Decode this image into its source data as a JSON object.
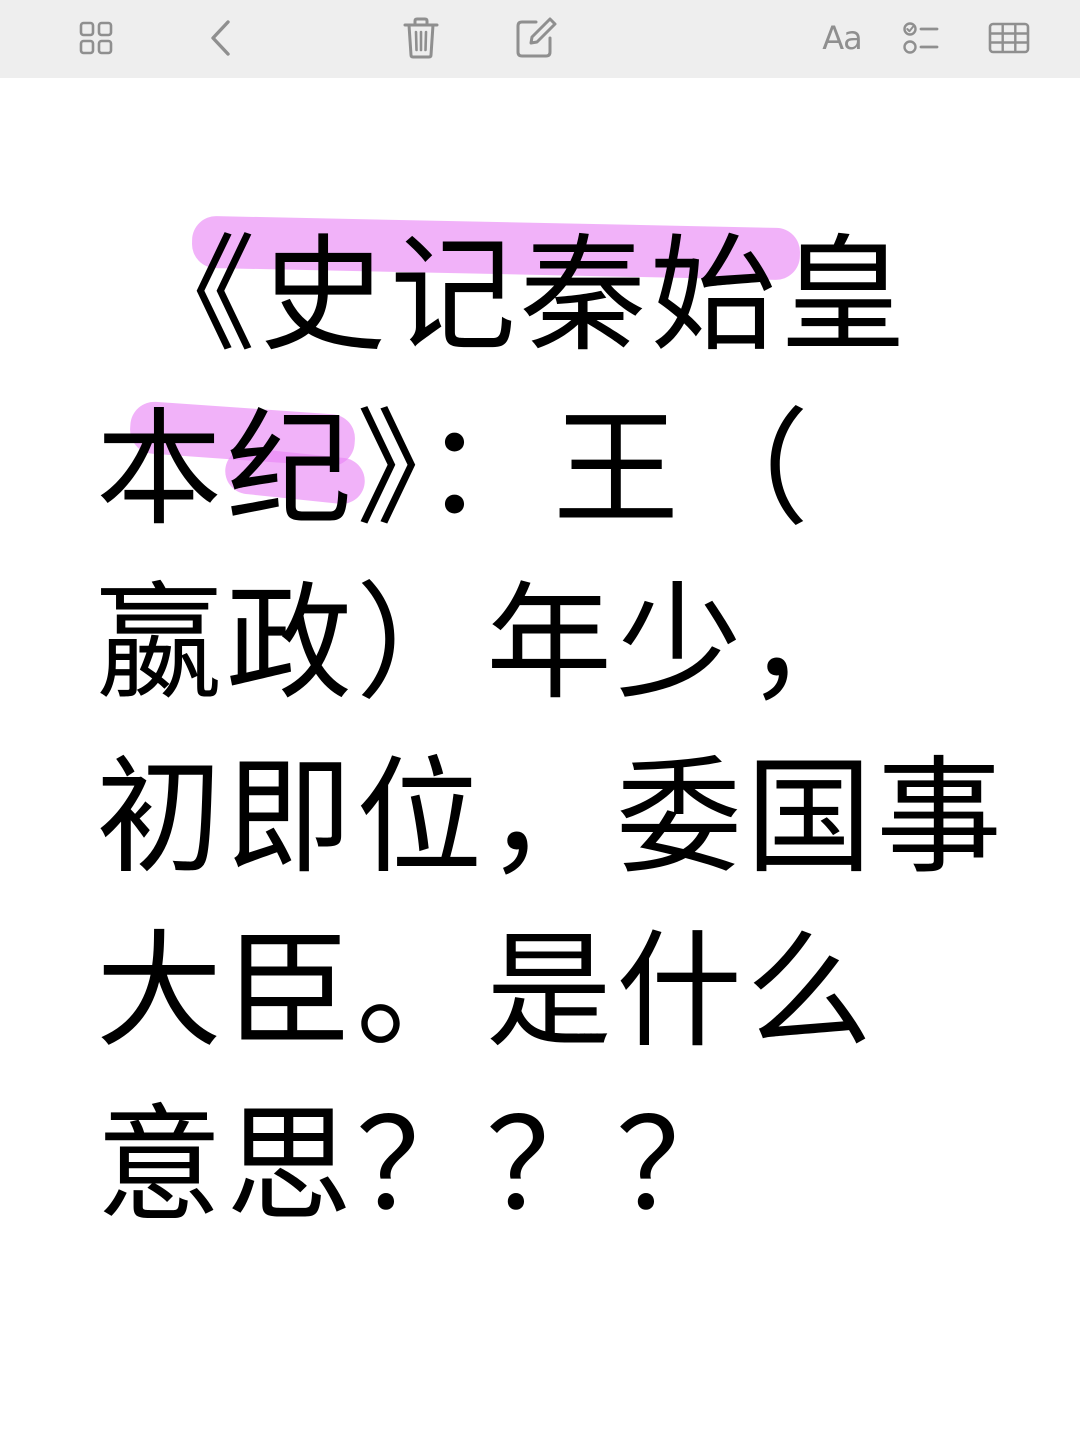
{
  "toolbar": {
    "buttons": [
      {
        "name": "gallery-view-button",
        "icon": "grid-icon"
      },
      {
        "name": "back-button",
        "icon": "chevron-left-icon"
      },
      {
        "name": "delete-button",
        "icon": "trash-icon"
      },
      {
        "name": "compose-button",
        "icon": "compose-icon"
      },
      {
        "name": "format-button",
        "icon": "text-format-icon",
        "label": "Aa"
      },
      {
        "name": "checklist-button",
        "icon": "checklist-icon"
      },
      {
        "name": "table-button",
        "icon": "table-icon"
      }
    ],
    "icon_color": "#8f8f8f",
    "background": "#eeeeee"
  },
  "note": {
    "lines": [
      "《史记秦始皇",
      "本纪》：王（",
      "嬴政）年少，",
      "初即位，委国事",
      "大臣。是什么",
      "意思？？？"
    ],
    "highlight_color": "#e882f5",
    "text_color": "#000000"
  }
}
